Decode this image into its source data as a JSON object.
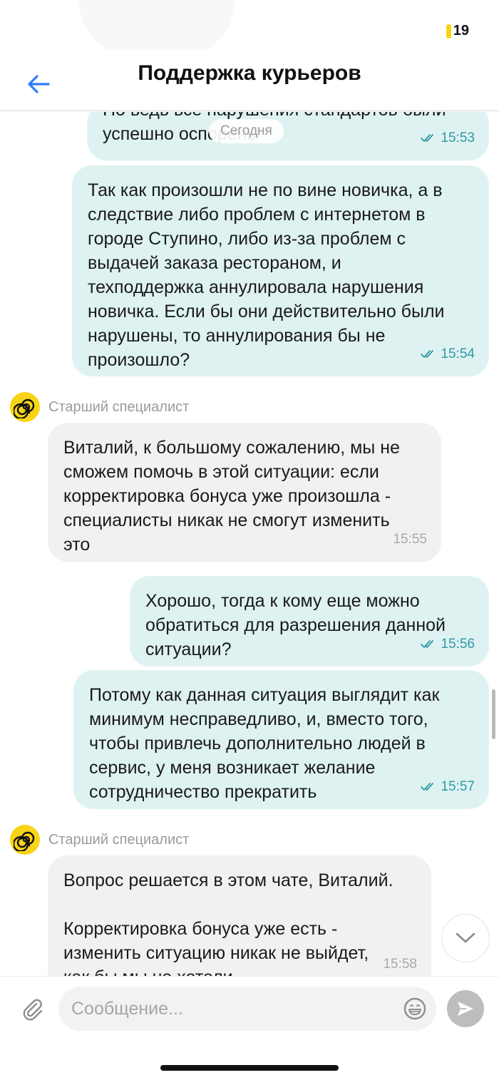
{
  "status_bar": {
    "battery": "19",
    "battery_color": "#f7d417"
  },
  "header": {
    "title": "Поддержка курьеров",
    "back_icon": "arrow-left-icon",
    "accent": "#2f7df6"
  },
  "date_separator": "Сегодня",
  "messages": [
    {
      "direction": "outgoing",
      "text": "Но ведь все нарушения стандартов были\nуспешно оспорены",
      "time": "15:53",
      "read": true
    },
    {
      "direction": "outgoing",
      "text": "Так как произошли не по вине новичка, а в\nследствие либо проблем с интернетом в\nгороде Ступино, либо из-за проблем с\nвыдачей заказа рестораном, и\nтехподдержка аннулировала нарушения\nновичка. Если бы они действительно были\nнарушены, то аннулирования бы не\nпроизошло?",
      "time": "15:54",
      "read": true
    },
    {
      "direction": "incoming",
      "sender": "Старший специалист",
      "text": "Виталий, к большому сожалению, мы не\nсможем помочь в этой ситуации: если\nкорректировка бонуса уже произошла -\nспециалисты никак не смогут изменить\nэто",
      "time": "15:55"
    },
    {
      "direction": "outgoing",
      "text": "Хорошо, тогда к кому еще можно\nобратиться для разрешения данной\nситуации?",
      "time": "15:56",
      "read": true
    },
    {
      "direction": "outgoing",
      "text": "Потому как данная ситуация выглядит как\nминимум несправедливо, и, вместо того,\nчтобы привлечь дополнительно людей в\nсервис, у меня возникает желание\nсотрудничество прекратить",
      "time": "15:57",
      "read": true
    },
    {
      "direction": "incoming",
      "sender": "Старший специалист",
      "text": "Вопрос решается в этом чате, Виталий.\n\nКорректировка бонуса уже есть -\nизменить ситуацию никак не выйдет,\nкак бы мы не хотели",
      "time": "15:58"
    }
  ],
  "composer": {
    "placeholder": "Сообщение...",
    "value": ""
  },
  "colors": {
    "outgoing_bubble": "#dff2f2",
    "incoming_bubble": "#f1f1f1",
    "tick": "#2e9aa6",
    "avatar": "#f7d417"
  }
}
